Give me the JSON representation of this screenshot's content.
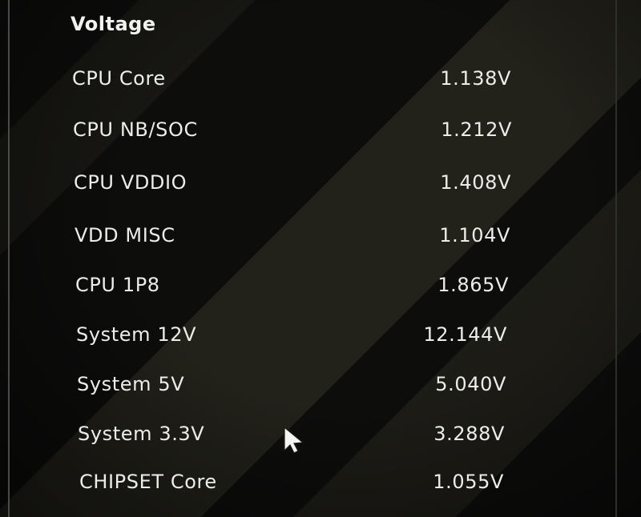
{
  "voltage_panel": {
    "title": "Voltage",
    "rows": [
      {
        "label": "CPU Core",
        "value": "1.138V"
      },
      {
        "label": "CPU NB/SOC",
        "value": "1.212V"
      },
      {
        "label": "CPU VDDIO",
        "value": "1.408V"
      },
      {
        "label": "VDD MISC",
        "value": "1.104V"
      },
      {
        "label": "CPU 1P8",
        "value": "1.865V"
      },
      {
        "label": "System 12V",
        "value": "12.144V"
      },
      {
        "label": "System 5V",
        "value": "5.040V"
      },
      {
        "label": "System 3.3V",
        "value": "3.288V"
      },
      {
        "label": "CHIPSET Core",
        "value": "1.055V"
      }
    ]
  },
  "icons": {
    "pointer": "mouse-pointer-icon"
  },
  "colors": {
    "background": "#0d0d0c",
    "stripe": "#34322a",
    "text": "#ececea"
  }
}
